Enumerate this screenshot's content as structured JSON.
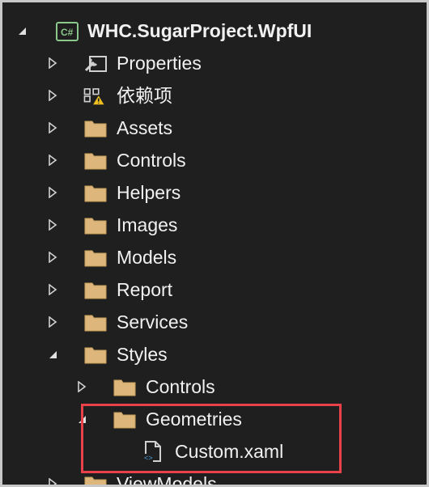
{
  "solution_explorer": {
    "project": {
      "name": "WHC.SugarProject.WpfUI",
      "badge": "C#",
      "expanded": true
    },
    "items": [
      {
        "label": "Properties",
        "icon": "properties-wrench-icon",
        "expanded": false
      },
      {
        "label": "依赖项",
        "icon": "dependencies-warning-icon",
        "expanded": false
      },
      {
        "label": "Assets",
        "icon": "folder-icon",
        "expanded": false
      },
      {
        "label": "Controls",
        "icon": "folder-icon",
        "expanded": false
      },
      {
        "label": "Helpers",
        "icon": "folder-icon",
        "expanded": false
      },
      {
        "label": "Images",
        "icon": "folder-icon",
        "expanded": false
      },
      {
        "label": "Models",
        "icon": "folder-icon",
        "expanded": false
      },
      {
        "label": "Report",
        "icon": "folder-icon",
        "expanded": false
      },
      {
        "label": "Services",
        "icon": "folder-icon",
        "expanded": false
      },
      {
        "label": "Styles",
        "icon": "folder-icon",
        "expanded": true
      },
      {
        "label": "Controls",
        "icon": "folder-icon",
        "expanded": false
      },
      {
        "label": "Geometries",
        "icon": "folder-icon",
        "expanded": true
      },
      {
        "label": "Custom.xaml",
        "icon": "xaml-file-icon"
      },
      {
        "label": "ViewModels",
        "icon": "folder-icon",
        "expanded": false
      }
    ],
    "highlight_color": "#e8414a",
    "folder_color": "#dcb67a"
  }
}
